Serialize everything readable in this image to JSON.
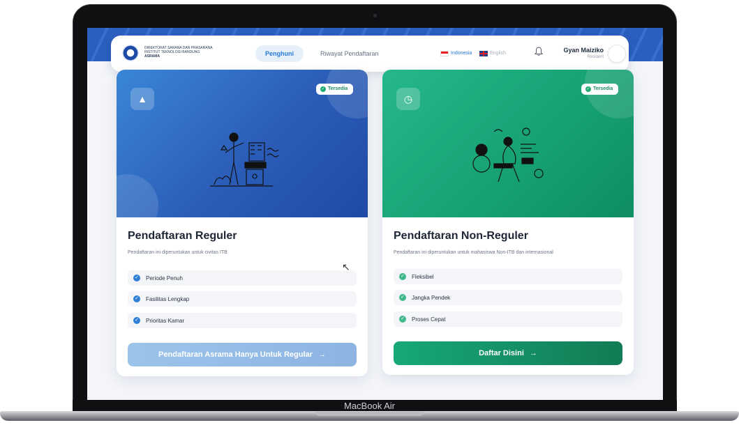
{
  "device": {
    "brand": "MacBook Air"
  },
  "header": {
    "logo_lines": [
      "DIREKTORAT SARANA DAN PRASARANA",
      "INSTITUT TEKNOLOGI BANDUNG",
      "ASRAMA"
    ],
    "tabs": [
      {
        "label": "Penghuni",
        "active": true
      },
      {
        "label": "Riwayat Pendaftaran",
        "active": false
      }
    ],
    "languages": [
      {
        "label": "Indonesia",
        "active": true
      },
      {
        "label": "English",
        "active": false
      }
    ],
    "user": {
      "name": "Gyan Maiziko",
      "role": "Resident"
    }
  },
  "cards": [
    {
      "badge": "Tersedia",
      "title": "Pendaftaran Reguler",
      "description": "Pendaftaran ini diperuntukan untuk civitas ITB",
      "features": [
        "Periode Penuh",
        "Fasilitas Lengkap",
        "Prioritas Kamar"
      ],
      "cta": "Pendaftaran Asrama Hanya Untuk Regular"
    },
    {
      "badge": "Tersedia",
      "title": "Pendaftaran Non-Reguler",
      "description": "Pendaftaran ini diperuntukan untuk mahasiswa Non-ITB dan internasional",
      "features": [
        "Fleksibel",
        "Jangka Pendek",
        "Proses Cepat"
      ],
      "cta": "Daftar Disini"
    }
  ],
  "colors": {
    "primary_blue": "#2b5db8",
    "primary_green": "#16a073",
    "accent_tab": "#2a7ad6"
  }
}
